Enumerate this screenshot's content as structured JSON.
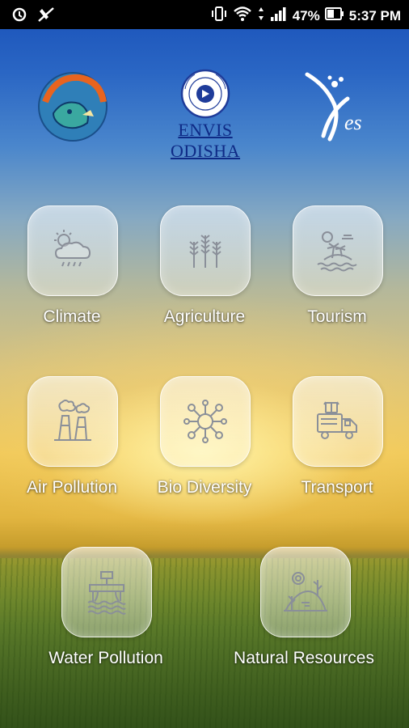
{
  "status_bar": {
    "battery_percent": "47%",
    "time": "5:37 PM",
    "icons": [
      "sync-icon",
      "mute-icon",
      "vibrate-icon",
      "wifi-icon",
      "data-arrows-icon",
      "signal-icon",
      "battery-icon"
    ]
  },
  "header": {
    "center_logo_text": "ENVIS ODISHA",
    "left_logo": "odisha-forest-department-emblem",
    "center_logo": "envis-circle-emblem",
    "right_logo": "xes-logo"
  },
  "menu": {
    "items": [
      {
        "label": "Climate",
        "icon": "climate-icon"
      },
      {
        "label": "Agriculture",
        "icon": "agriculture-icon"
      },
      {
        "label": "Tourism",
        "icon": "tourism-icon"
      },
      {
        "label": "Air Pollution",
        "icon": "air-pollution-icon"
      },
      {
        "label": "Bio Diversity",
        "icon": "biodiversity-icon"
      },
      {
        "label": "Transport",
        "icon": "transport-icon"
      },
      {
        "label": "Water Pollution",
        "icon": "water-pollution-icon"
      },
      {
        "label": "Natural Resources",
        "icon": "natural-resources-icon"
      }
    ]
  },
  "colors": {
    "icon_stroke": "#8a8f99",
    "label_text": "#ffffff",
    "header_text": "#0e2a86"
  }
}
